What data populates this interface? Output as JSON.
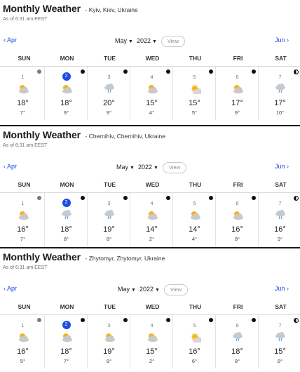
{
  "panels": [
    {
      "title": "Monthly Weather",
      "location": "Kyiv, Kiev, Ukraine",
      "as_of": "As of 6:31 am EEST",
      "prev": "Apr",
      "next": "Jun",
      "month": "May",
      "year": "2022",
      "view": "View",
      "days": [
        "SUN",
        "MON",
        "TUE",
        "WED",
        "THU",
        "FRI",
        "SAT"
      ],
      "cells": [
        {
          "num": "1",
          "hi": "18°",
          "lo": "7°",
          "icon": "partly-cloudy-icon",
          "moon": "new-moon-icon"
        },
        {
          "num": "2",
          "hi": "18°",
          "lo": "9°",
          "icon": "partly-cloudy-icon",
          "moon": "waxing-crescent-icon",
          "today": true
        },
        {
          "num": "3",
          "hi": "20°",
          "lo": "9°",
          "icon": "showers-icon",
          "moon": "waxing-crescent-icon"
        },
        {
          "num": "4",
          "hi": "15°",
          "lo": "4°",
          "icon": "partly-cloudy-icon",
          "moon": "waxing-crescent-icon"
        },
        {
          "num": "5",
          "hi": "15°",
          "lo": "5°",
          "icon": "sunny-icon",
          "moon": "waxing-crescent-icon"
        },
        {
          "num": "6",
          "hi": "17°",
          "lo": "9°",
          "icon": "partly-cloudy-icon",
          "moon": "waxing-crescent-icon"
        },
        {
          "num": "7",
          "hi": "17°",
          "lo": "10°",
          "icon": "showers-icon",
          "moon": "first-quarter-icon"
        }
      ]
    },
    {
      "title": "Monthly Weather",
      "location": "Chernihiv, Chernihiv, Ukraine",
      "as_of": "As of 6:31 am EEST",
      "prev": "Apr",
      "next": "Jun",
      "month": "May",
      "year": "2022",
      "view": "View",
      "days": [
        "SUN",
        "MON",
        "TUE",
        "WED",
        "THU",
        "FRI",
        "SAT"
      ],
      "cells": [
        {
          "num": "1",
          "hi": "16°",
          "lo": "7°",
          "icon": "partly-cloudy-icon",
          "moon": "new-moon-icon"
        },
        {
          "num": "2",
          "hi": "18°",
          "lo": "8°",
          "icon": "showers-icon",
          "moon": "waxing-crescent-icon",
          "today": true
        },
        {
          "num": "3",
          "hi": "19°",
          "lo": "8°",
          "icon": "showers-icon",
          "moon": "waxing-crescent-icon"
        },
        {
          "num": "4",
          "hi": "14°",
          "lo": "2°",
          "icon": "partly-cloudy-icon",
          "moon": "waxing-crescent-icon"
        },
        {
          "num": "5",
          "hi": "14°",
          "lo": "4°",
          "icon": "partly-cloudy-icon",
          "moon": "waxing-crescent-icon"
        },
        {
          "num": "6",
          "hi": "16°",
          "lo": "8°",
          "icon": "partly-cloudy-icon",
          "moon": "waxing-crescent-icon"
        },
        {
          "num": "7",
          "hi": "16°",
          "lo": "9°",
          "icon": "showers-icon",
          "moon": "first-quarter-icon"
        }
      ]
    },
    {
      "title": "Monthly Weather",
      "location": "Zhytomyr, Zhytomyr, Ukraine",
      "as_of": "As of 6:31 am EEST",
      "prev": "Apr",
      "next": "Jun",
      "month": "May",
      "year": "2022",
      "view": "View",
      "days": [
        "SUN",
        "MON",
        "TUE",
        "WED",
        "THU",
        "FRI",
        "SAT"
      ],
      "cells": [
        {
          "num": "1",
          "hi": "16°",
          "lo": "5°",
          "icon": "partly-cloudy-icon",
          "moon": "new-moon-icon"
        },
        {
          "num": "2",
          "hi": "18°",
          "lo": "7°",
          "icon": "partly-cloudy-icon",
          "moon": "waxing-crescent-icon",
          "today": true
        },
        {
          "num": "3",
          "hi": "19°",
          "lo": "8°",
          "icon": "partly-cloudy-icon",
          "moon": "waxing-crescent-icon"
        },
        {
          "num": "4",
          "hi": "15°",
          "lo": "2°",
          "icon": "partly-cloudy-icon",
          "moon": "waxing-crescent-icon"
        },
        {
          "num": "5",
          "hi": "16°",
          "lo": "6°",
          "icon": "sunny-icon",
          "moon": "waxing-crescent-icon"
        },
        {
          "num": "6",
          "hi": "18°",
          "lo": "8°",
          "icon": "showers-icon",
          "moon": "waxing-crescent-icon"
        },
        {
          "num": "7",
          "hi": "15°",
          "lo": "8°",
          "icon": "showers-icon",
          "moon": "first-quarter-icon"
        }
      ]
    }
  ],
  "colors": {
    "accent": "#1b4de4",
    "sun": "#f5b51f",
    "cloud": "#c9c9c9",
    "rain": "#3a8fd6"
  }
}
